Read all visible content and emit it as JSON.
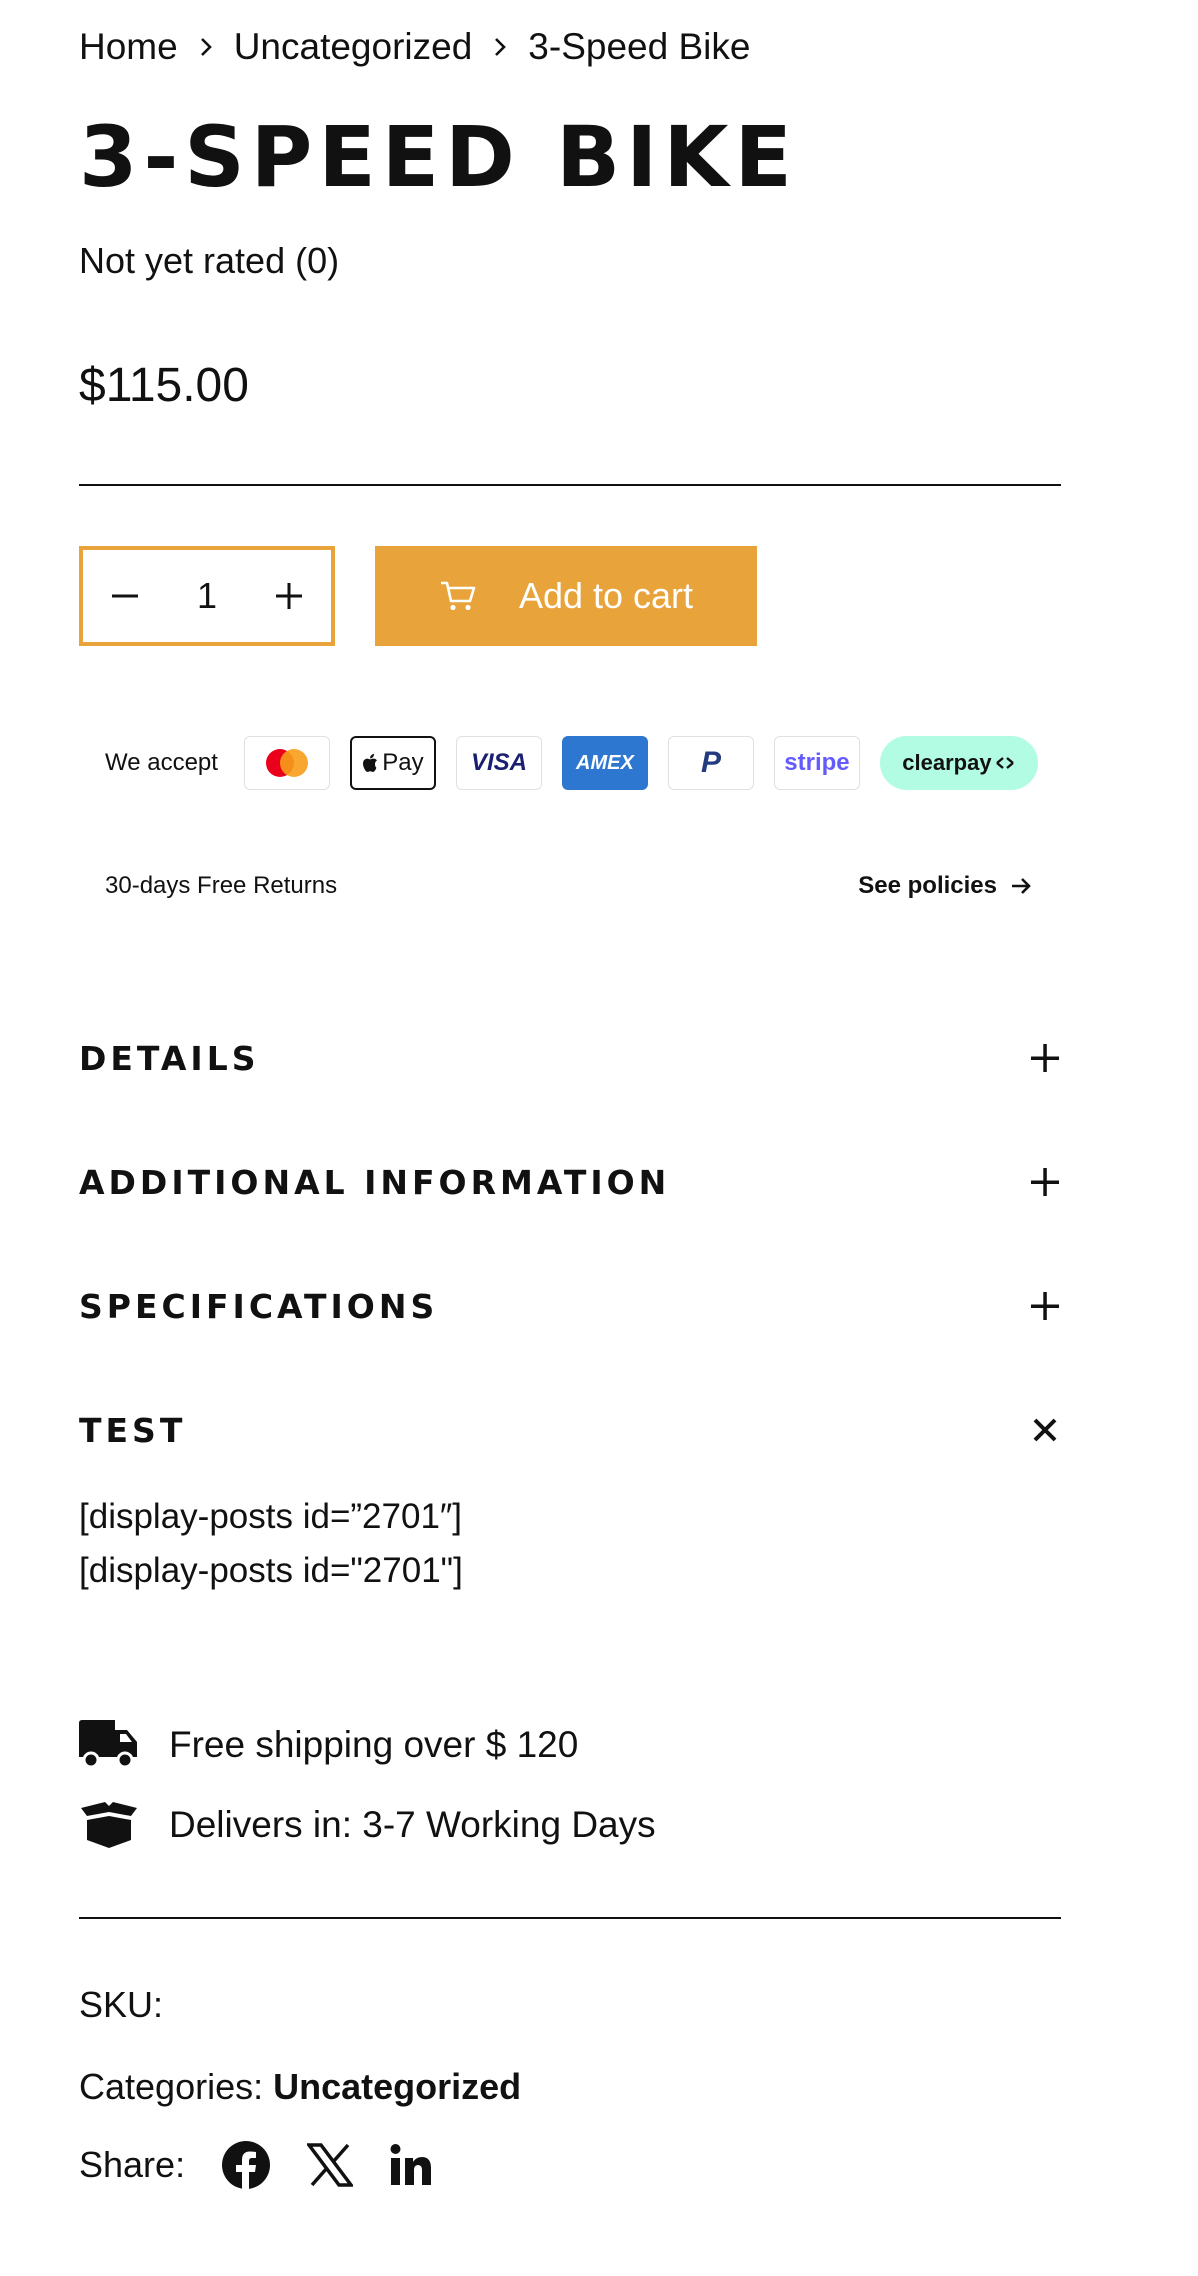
{
  "breadcrumb": {
    "home": "Home",
    "category": "Uncategorized",
    "current": "3-Speed Bike"
  },
  "product": {
    "title": "3-Speed Bike",
    "rating": "Not yet rated (0)",
    "price": "$115.00",
    "quantity": "1",
    "add_to_cart": "Add to cart"
  },
  "payments": {
    "label": "We accept",
    "methods": [
      "mastercard",
      "apple-pay",
      "visa",
      "amex",
      "paypal",
      "stripe",
      "clearpay"
    ],
    "applepay_text": "Pay",
    "visa_text": "VISA",
    "amex_text": "AMEX",
    "paypal_text": "P",
    "stripe_text": "stripe",
    "clearpay_text": "clearpay"
  },
  "returns": {
    "text": "30-days Free Returns",
    "link": "See policies"
  },
  "accordion": [
    {
      "title": "Details",
      "icon": "plus-icon"
    },
    {
      "title": "Additional information",
      "icon": "plus-icon"
    },
    {
      "title": "Specifications",
      "icon": "plus-icon"
    },
    {
      "title": "Test",
      "icon": "close-icon"
    }
  ],
  "test_content": {
    "line1": "[display-posts id=”2701″]",
    "line2": "[display-posts id=\"2701\"]"
  },
  "features": {
    "shipping": "Free shipping over $ 120",
    "delivery": "Delivers in: 3-7 Working Days"
  },
  "meta": {
    "sku_label": "SKU:",
    "categories_label": "Categories:",
    "categories_value": "Uncategorized",
    "share_label": "Share:"
  },
  "colors": {
    "accent": "#e8a33a",
    "text": "#111111",
    "clearpay_bg": "#b2fce4",
    "amex_bg": "#2e77d0"
  }
}
